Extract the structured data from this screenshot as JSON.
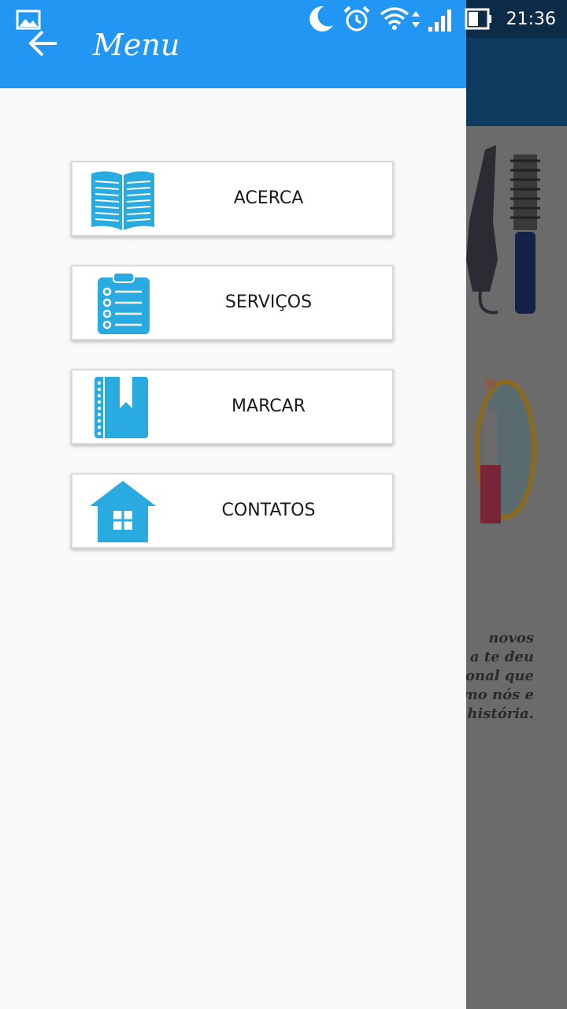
{
  "status_bar": {
    "time": "21:36",
    "icons": [
      "gallery-icon",
      "moon-icon",
      "alarm-icon",
      "wifi-icon",
      "signal-icon",
      "battery-icon"
    ]
  },
  "drawer": {
    "title": "Menu",
    "back_icon": "arrow-left-icon",
    "items": [
      {
        "label": "ACERCA",
        "icon": "open-book-icon"
      },
      {
        "label": "SERVIÇOS",
        "icon": "clipboard-checklist-icon"
      },
      {
        "label": "MARCAR",
        "icon": "bookmark-notebook-icon"
      },
      {
        "label": "CONTATOS",
        "icon": "house-icon"
      }
    ]
  },
  "background_page": {
    "text_lines": [
      "novos",
      "a te deu",
      "onal que",
      "omo nós e",
      "história."
    ]
  },
  "colors": {
    "header": "#2196f3",
    "icon_blue": "#29abe2",
    "drawer_bg": "#f9f9f9",
    "scrim": "#6b6b6b"
  }
}
